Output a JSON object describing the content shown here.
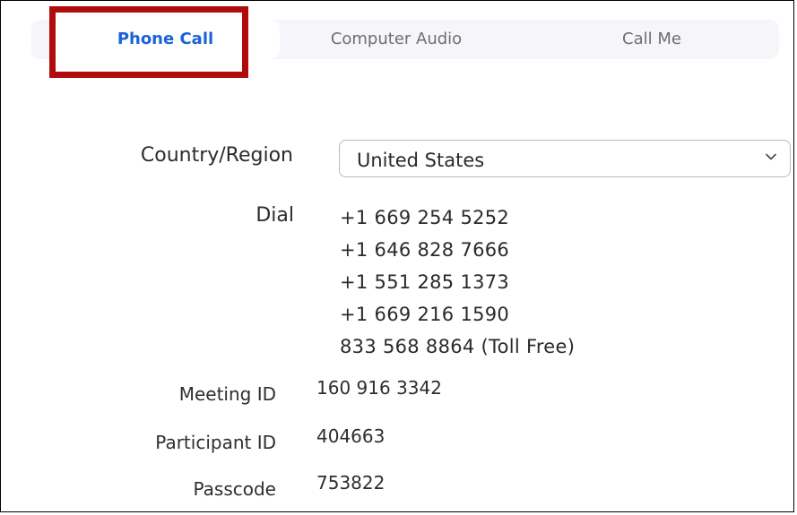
{
  "tabs": [
    {
      "label": "Phone Call",
      "active": true
    },
    {
      "label": "Computer Audio",
      "active": false
    },
    {
      "label": "Call Me",
      "active": false
    }
  ],
  "form": {
    "country_label": "Country/Region",
    "country_value": "United States",
    "dial_label": "Dial",
    "dial_numbers": [
      "+1 669 254 5252",
      "+1 646 828 7666",
      "+1 551 285 1373",
      "+1 669 216 1590",
      "833 568 8864 (Toll Free)"
    ],
    "meeting_id_label": "Meeting ID",
    "meeting_id": "160 916 3342",
    "participant_id_label": "Participant ID",
    "participant_id": "404663",
    "passcode_label": "Passcode",
    "passcode": "753822"
  },
  "colors": {
    "active_tab": "#1a63d8",
    "highlight": "#b00c0c",
    "tab_bar_bg": "#f6f6fa"
  },
  "icons": {
    "dropdown": "chevron-down-icon"
  }
}
